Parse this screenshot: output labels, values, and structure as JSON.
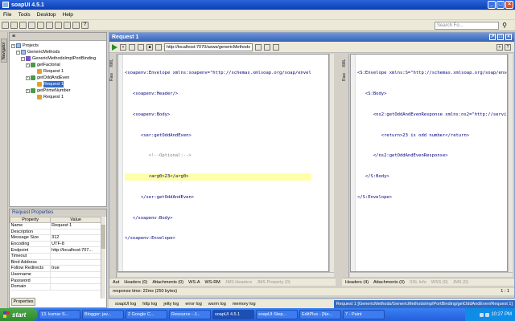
{
  "window": {
    "title": "soapUI 4.5.1"
  },
  "menu": [
    "File",
    "Tools",
    "Desktop",
    "Help"
  ],
  "search": {
    "placeholder": "Search Fo..."
  },
  "left_strip": {
    "navigator_tab": "Navigator"
  },
  "navigator": {
    "header": "≡",
    "tree": [
      {
        "label": "Projects",
        "level": 0,
        "icon": "folder-icon"
      },
      {
        "label": "GenericMethods",
        "level": 1,
        "icon": "project-icon"
      },
      {
        "label": "GenericMethodsImplPortBinding",
        "level": 2,
        "icon": "interface-icon"
      },
      {
        "label": "getFactorial",
        "level": 3,
        "icon": "operation-icon"
      },
      {
        "label": "Request 1",
        "level": 4,
        "icon": "request-icon"
      },
      {
        "label": "getOddAndEven",
        "level": 3,
        "icon": "operation-icon"
      },
      {
        "label": "Request 1",
        "level": 4,
        "icon": "request-icon",
        "selected": true
      },
      {
        "label": "getPrimeNumber",
        "level": 3,
        "icon": "operation-icon"
      },
      {
        "label": "Request 1",
        "level": 4,
        "icon": "request-icon"
      }
    ]
  },
  "properties": {
    "title": "Request Properties",
    "col_property": "Property",
    "col_value": "Value",
    "rows": [
      [
        "Name",
        "Request 1"
      ],
      [
        "Description",
        ""
      ],
      [
        "Message Size",
        "312"
      ],
      [
        "Encoding",
        "UTF-8"
      ],
      [
        "Endpoint",
        "http://localhost:707..."
      ],
      [
        "Timeout",
        ""
      ],
      [
        "Bind Address",
        ""
      ],
      [
        "Follow Redirects",
        "true"
      ],
      [
        "Username",
        ""
      ],
      [
        "Password",
        ""
      ],
      [
        "Domain",
        ""
      ]
    ],
    "button": "Properties"
  },
  "request": {
    "title": "Request 1",
    "endpoint": "http://localhost:7070/axws/genericMethods",
    "left_side_tabs": [
      "XML",
      "Raw"
    ],
    "right_side_tabs": [
      "XML",
      "Raw"
    ],
    "request_xml": [
      "<soapenv:Envelope xmlns:soapenv=\"http://schemas.xmlsoap.org/soap/envel",
      "   <soapenv:Header/>",
      "   <soapenv:Body>",
      "      <ser:getOddAndEven>",
      "         <!--Optional:-->",
      "         <arg0>23</arg0>",
      "      </ser:getOddAndEven>",
      "   </soapenv:Body>",
      "</soapenv:Envelope>"
    ],
    "highlight_line": 5,
    "response_xml": [
      "<S:Envelope xmlns:S=\"http://schemas.xmlsoap.org/soap/enve",
      "   <S:Body>",
      "      <ns2:getOddAndEvenResponse xmlns:ns2=\"http://servi",
      "         <return>23 is odd number</return>",
      "      </ns2:getOddAndEvenResponse>",
      "   </S:Body>",
      "</S:Envelope>"
    ],
    "request_tabs": [
      "Aut",
      "Headers (0)",
      "Attachments (0)",
      "WS-A",
      "WS-RM",
      "JMS Headers",
      "JMS Property (0)"
    ],
    "response_tabs": [
      "Headers (4)",
      "Attachments (0)",
      "SSL Info",
      "WSS (0)",
      "JMS (0)"
    ],
    "response_time": "response time: 22ms (250 bytes)",
    "cursor_pos": "1 : 1"
  },
  "logs": [
    "soapUI log",
    "http log",
    "jetty log",
    "error log",
    "wsrm log",
    "memory log"
  ],
  "breadcrumb": "Request 1 [GenericMethods/GenericMethodsImplPortBinding/getOddAndEven/Request 1]",
  "taskbar": {
    "start": "start",
    "tasks": [
      "13. kumar S...",
      "Blogger: jav...",
      "2 Google C...",
      "Resource - J...",
      "soapUI 4.5.1",
      "soapUI-Step...",
      "EditPlus - [Ne...",
      "7 - Paint"
    ],
    "active_index": 4,
    "clock": "10:27 PM"
  }
}
